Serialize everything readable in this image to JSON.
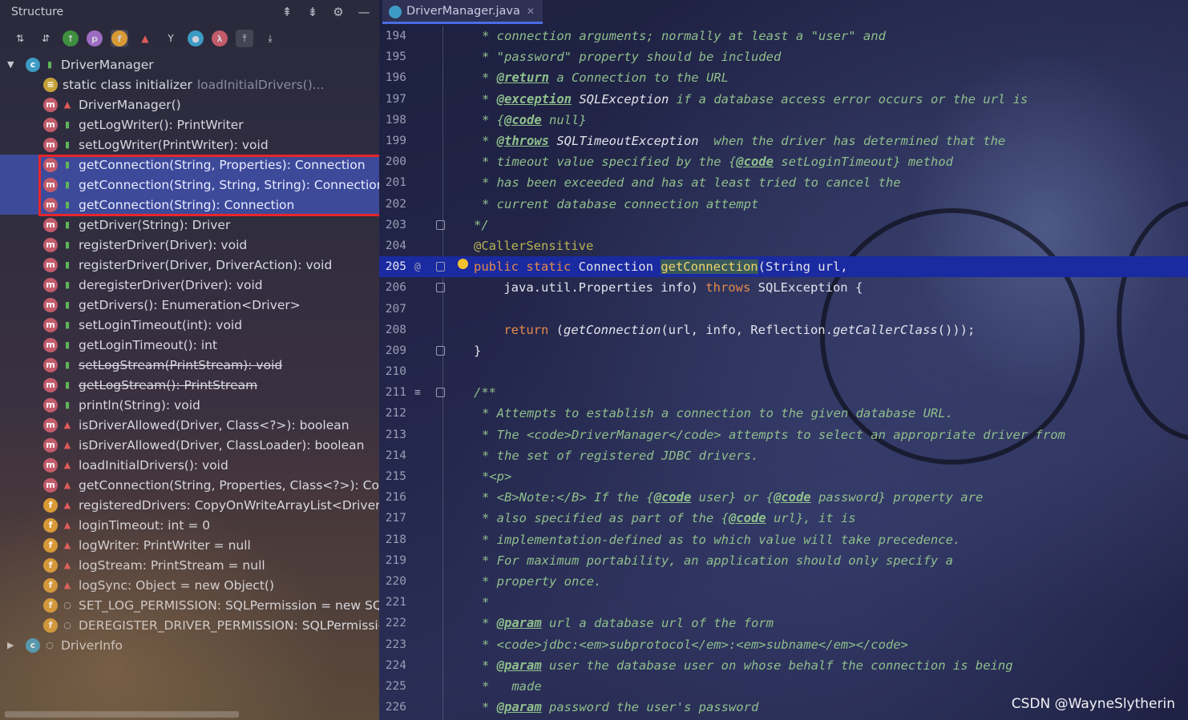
{
  "structure_panel": {
    "title": "Structure",
    "tree": [
      {
        "label": "DriverManager",
        "badge": "c",
        "vis": "pub",
        "indent": 0,
        "arrow": "▼"
      },
      {
        "label": "static class initializer",
        "hint": "loadInitialDrivers()...",
        "badge": "s",
        "vis": "none",
        "indent": 1
      },
      {
        "label": "DriverManager()",
        "badge": "m",
        "vis": "priv",
        "indent": 1
      },
      {
        "label": "getLogWriter(): PrintWriter",
        "badge": "m",
        "vis": "pub",
        "indent": 1
      },
      {
        "label": "setLogWriter(PrintWriter): void",
        "badge": "m",
        "vis": "pub",
        "indent": 1
      },
      {
        "label": "getConnection(String, Properties): Connection",
        "badge": "m",
        "vis": "pub",
        "indent": 1,
        "selected": true
      },
      {
        "label": "getConnection(String, String, String): Connection",
        "badge": "m",
        "vis": "pub",
        "indent": 1,
        "selected": true
      },
      {
        "label": "getConnection(String): Connection",
        "badge": "m",
        "vis": "pub",
        "indent": 1,
        "selected": true
      },
      {
        "label": "getDriver(String): Driver",
        "badge": "m",
        "vis": "pub",
        "indent": 1
      },
      {
        "label": "registerDriver(Driver): void",
        "badge": "m",
        "vis": "pub",
        "indent": 1
      },
      {
        "label": "registerDriver(Driver, DriverAction): void",
        "badge": "m",
        "vis": "pub",
        "indent": 1
      },
      {
        "label": "deregisterDriver(Driver): void",
        "badge": "m",
        "vis": "pub",
        "indent": 1
      },
      {
        "label": "getDrivers(): Enumeration<Driver>",
        "badge": "m",
        "vis": "pub",
        "indent": 1
      },
      {
        "label": "setLoginTimeout(int): void",
        "badge": "m",
        "vis": "pub",
        "indent": 1
      },
      {
        "label": "getLoginTimeout(): int",
        "badge": "m",
        "vis": "pub",
        "indent": 1
      },
      {
        "label": "setLogStream(PrintStream): void",
        "badge": "m",
        "vis": "pub",
        "indent": 1,
        "strike": true
      },
      {
        "label": "getLogStream(): PrintStream",
        "badge": "m",
        "vis": "pub",
        "indent": 1,
        "strike": true
      },
      {
        "label": "println(String): void",
        "badge": "m",
        "vis": "pub",
        "indent": 1
      },
      {
        "label": "isDriverAllowed(Driver, Class<?>): boolean",
        "badge": "m",
        "vis": "priv",
        "indent": 1
      },
      {
        "label": "isDriverAllowed(Driver, ClassLoader): boolean",
        "badge": "m",
        "vis": "priv",
        "indent": 1
      },
      {
        "label": "loadInitialDrivers(): void",
        "badge": "m",
        "vis": "priv",
        "indent": 1
      },
      {
        "label": "getConnection(String, Properties, Class<?>): Conne",
        "badge": "m",
        "vis": "priv",
        "indent": 1
      },
      {
        "label": "registeredDrivers: CopyOnWriteArrayList<DriverInf",
        "badge": "f",
        "vis": "priv",
        "indent": 1
      },
      {
        "label": "loginTimeout: int = 0",
        "badge": "f",
        "vis": "priv",
        "indent": 1
      },
      {
        "label": "logWriter: PrintWriter = null",
        "badge": "f",
        "vis": "priv",
        "indent": 1
      },
      {
        "label": "logStream: PrintStream = null",
        "badge": "f",
        "vis": "priv",
        "indent": 1
      },
      {
        "label": "logSync: Object = new Object()",
        "badge": "f",
        "vis": "priv",
        "indent": 1
      },
      {
        "label": "SET_LOG_PERMISSION: SQLPermission = new SQLP",
        "badge": "f",
        "vis": "pkg",
        "indent": 1
      },
      {
        "label": "DEREGISTER_DRIVER_PERMISSION: SQLPermission =",
        "badge": "f",
        "vis": "pkg",
        "indent": 1
      },
      {
        "label": "DriverInfo",
        "badge": "c",
        "vis": "pkg",
        "indent": 0,
        "arrow": "▶"
      }
    ]
  },
  "editor": {
    "tab_label": "DriverManager.java",
    "current_line": 205,
    "lines": [
      {
        "n": "194",
        "code": [
          [
            "c-doc",
            "* connection arguments; normally at least a \"user\" and"
          ]
        ]
      },
      {
        "n": "195",
        "code": [
          [
            "c-doc",
            "* \"password\" property should be included"
          ]
        ]
      },
      {
        "n": "196",
        "code": [
          [
            "c-doc",
            "* "
          ],
          [
            "c-tag",
            "@return"
          ],
          [
            "c-doc",
            " a Connection to the URL"
          ]
        ]
      },
      {
        "n": "197",
        "code": [
          [
            "c-doc",
            "* "
          ],
          [
            "c-tag",
            "@exception"
          ],
          [
            "c-ital",
            " SQLException"
          ],
          [
            "c-doc",
            " if a database access error occurs or the url is"
          ]
        ]
      },
      {
        "n": "198",
        "code": [
          [
            "c-doc",
            "* {"
          ],
          [
            "c-tag",
            "@code"
          ],
          [
            "c-doc",
            " null}"
          ]
        ]
      },
      {
        "n": "199",
        "code": [
          [
            "c-doc",
            "* "
          ],
          [
            "c-tag",
            "@throws"
          ],
          [
            "c-ital",
            " SQLTimeoutException"
          ],
          [
            "c-doc",
            "  when the driver has determined that the"
          ]
        ]
      },
      {
        "n": "200",
        "code": [
          [
            "c-doc",
            "* timeout value specified by the {"
          ],
          [
            "c-tag",
            "@code"
          ],
          [
            "c-doc",
            " setLoginTimeout} method"
          ]
        ]
      },
      {
        "n": "201",
        "code": [
          [
            "c-doc",
            "* has been exceeded and has at least tried to cancel the"
          ]
        ]
      },
      {
        "n": "202",
        "code": [
          [
            "c-doc",
            "* current database connection attempt"
          ]
        ]
      },
      {
        "n": "203",
        "fold": true,
        "code": [
          [
            "c-doc",
            "*/"
          ]
        ],
        "indent": -10
      },
      {
        "n": "204",
        "code": [
          [
            "c-anno",
            "@CallerSensitive"
          ]
        ],
        "indent": -10
      },
      {
        "n": "205",
        "cur": true,
        "at": "@",
        "bulb": true,
        "fold": true,
        "code": [
          [
            "c-kw",
            "public static "
          ],
          [
            "c-plain",
            "Connection "
          ],
          [
            "c-mth-hl",
            "getConnection"
          ],
          [
            "c-plain",
            "(String url,"
          ]
        ],
        "indent": -10
      },
      {
        "n": "206",
        "fold": true,
        "code": [
          [
            "c-plain",
            "    java.util.Properties info) "
          ],
          [
            "c-kw",
            "throws "
          ],
          [
            "c-plain",
            "SQLException {"
          ]
        ],
        "indent": -10
      },
      {
        "n": "207",
        "code": []
      },
      {
        "n": "208",
        "code": [
          [
            "c-plain",
            "    "
          ],
          [
            "c-kw",
            "return "
          ],
          [
            "c-plain",
            "("
          ],
          [
            "c-ident",
            "getConnection"
          ],
          [
            "c-plain",
            "(url, info, Reflection."
          ],
          [
            "c-ident",
            "getCallerClass"
          ],
          [
            "c-plain",
            "()));"
          ]
        ],
        "indent": -10
      },
      {
        "n": "209",
        "fold": true,
        "code": [
          [
            "c-plain",
            "}"
          ]
        ],
        "indent": -10
      },
      {
        "n": "210",
        "code": []
      },
      {
        "n": "211",
        "at": "≡",
        "fold": true,
        "code": [
          [
            "c-doc",
            "/**"
          ]
        ],
        "indent": -10
      },
      {
        "n": "212",
        "code": [
          [
            "c-doc",
            "* Attempts to establish a connection to the given database URL."
          ]
        ]
      },
      {
        "n": "213",
        "code": [
          [
            "c-doc",
            "* The <code>DriverManager</code> attempts to select an appropriate driver from"
          ]
        ]
      },
      {
        "n": "214",
        "code": [
          [
            "c-doc",
            "* the set of registered JDBC drivers."
          ]
        ]
      },
      {
        "n": "215",
        "code": [
          [
            "c-doc",
            "*<p>"
          ]
        ]
      },
      {
        "n": "216",
        "code": [
          [
            "c-doc",
            "* <B>Note:</B> If the {"
          ],
          [
            "c-tag",
            "@code"
          ],
          [
            "c-doc",
            " user} or {"
          ],
          [
            "c-tag",
            "@code"
          ],
          [
            "c-doc",
            " password} property are"
          ]
        ]
      },
      {
        "n": "217",
        "code": [
          [
            "c-doc",
            "* also specified as part of the {"
          ],
          [
            "c-tag",
            "@code"
          ],
          [
            "c-doc",
            " url}, it is"
          ]
        ]
      },
      {
        "n": "218",
        "code": [
          [
            "c-doc",
            "* implementation-defined as to which value will take precedence."
          ]
        ]
      },
      {
        "n": "219",
        "code": [
          [
            "c-doc",
            "* For maximum portability, an application should only specify a"
          ]
        ]
      },
      {
        "n": "220",
        "code": [
          [
            "c-doc",
            "* property once."
          ]
        ]
      },
      {
        "n": "221",
        "code": [
          [
            "c-doc",
            "*"
          ]
        ]
      },
      {
        "n": "222",
        "code": [
          [
            "c-doc",
            "* "
          ],
          [
            "c-tag",
            "@param"
          ],
          [
            "c-doc",
            " url a database url of the form"
          ]
        ]
      },
      {
        "n": "223",
        "code": [
          [
            "c-doc",
            "* <code>jdbc:<em>subprotocol</em>:<em>subname</em></code>"
          ]
        ]
      },
      {
        "n": "224",
        "code": [
          [
            "c-doc",
            "* "
          ],
          [
            "c-tag",
            "@param"
          ],
          [
            "c-doc",
            " user the database user on whose behalf the connection is being"
          ]
        ]
      },
      {
        "n": "225",
        "code": [
          [
            "c-doc",
            "*   made"
          ]
        ]
      },
      {
        "n": "226",
        "code": [
          [
            "c-doc",
            "* "
          ],
          [
            "c-tag",
            "@param"
          ],
          [
            "c-doc",
            " password the user's password"
          ]
        ]
      }
    ]
  },
  "watermark": "CSDN @WayneSlytherin"
}
